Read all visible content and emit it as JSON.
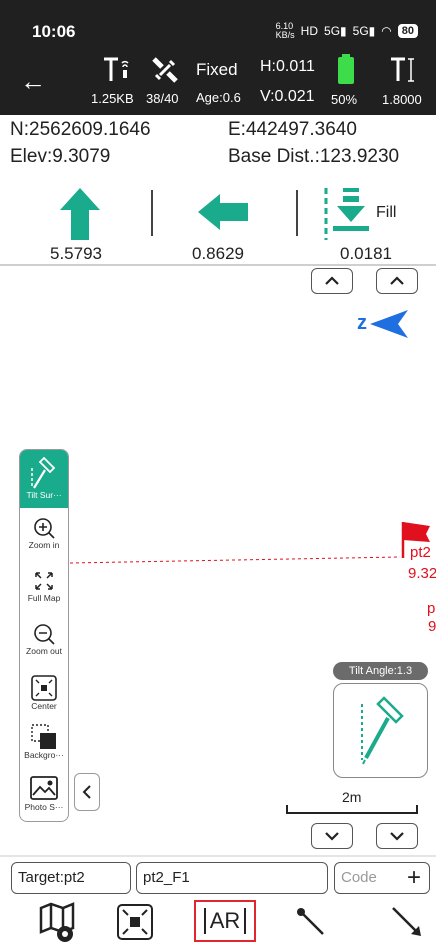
{
  "status_bar": {
    "time": "10:06",
    "net_speed": "6.10 KB/s",
    "signal": "5G",
    "battery": "80"
  },
  "header": {
    "link_speed": "1.25KB",
    "satellites": "38/40",
    "fix_status": "Fixed",
    "age": "Age:0.6",
    "h_precision": "H:0.011",
    "v_precision": "V:0.021",
    "battery_percent": "50%",
    "pole_height": "1.8000"
  },
  "coordinates": {
    "north": "N:2562609.1646",
    "east": "E:442497.3640",
    "elevation": "Elev:9.3079",
    "base_distance": "Base Dist.:123.9230"
  },
  "guidance": {
    "forward_value": "5.5793",
    "left_value": "0.8629",
    "fill_value": "0.0181",
    "fill_label": "Fill"
  },
  "map": {
    "compass_letter": "z",
    "point_label_1": "pt2",
    "point_elev_1": "9.32",
    "point_label_2": "p",
    "point_elev_2": "9",
    "tilt_angle": "Tilt Angle:1.3",
    "scale": "2m"
  },
  "tools": [
    {
      "label": "Tilt Sur···"
    },
    {
      "label": "Zoom in"
    },
    {
      "label": "Full Map"
    },
    {
      "label": "Zoom out"
    },
    {
      "label": "Center"
    },
    {
      "label": "Backgro···"
    },
    {
      "label": "Photo S···"
    }
  ],
  "bottom": {
    "target": "Target:pt2",
    "point_name": "pt2_F1",
    "code_placeholder": "Code",
    "ar_label": "AR"
  },
  "colors": {
    "accent": "#1aaa8c",
    "compass": "#1f6fe0",
    "map_point": "#e0101e",
    "highlight_border": "#e0262e"
  }
}
